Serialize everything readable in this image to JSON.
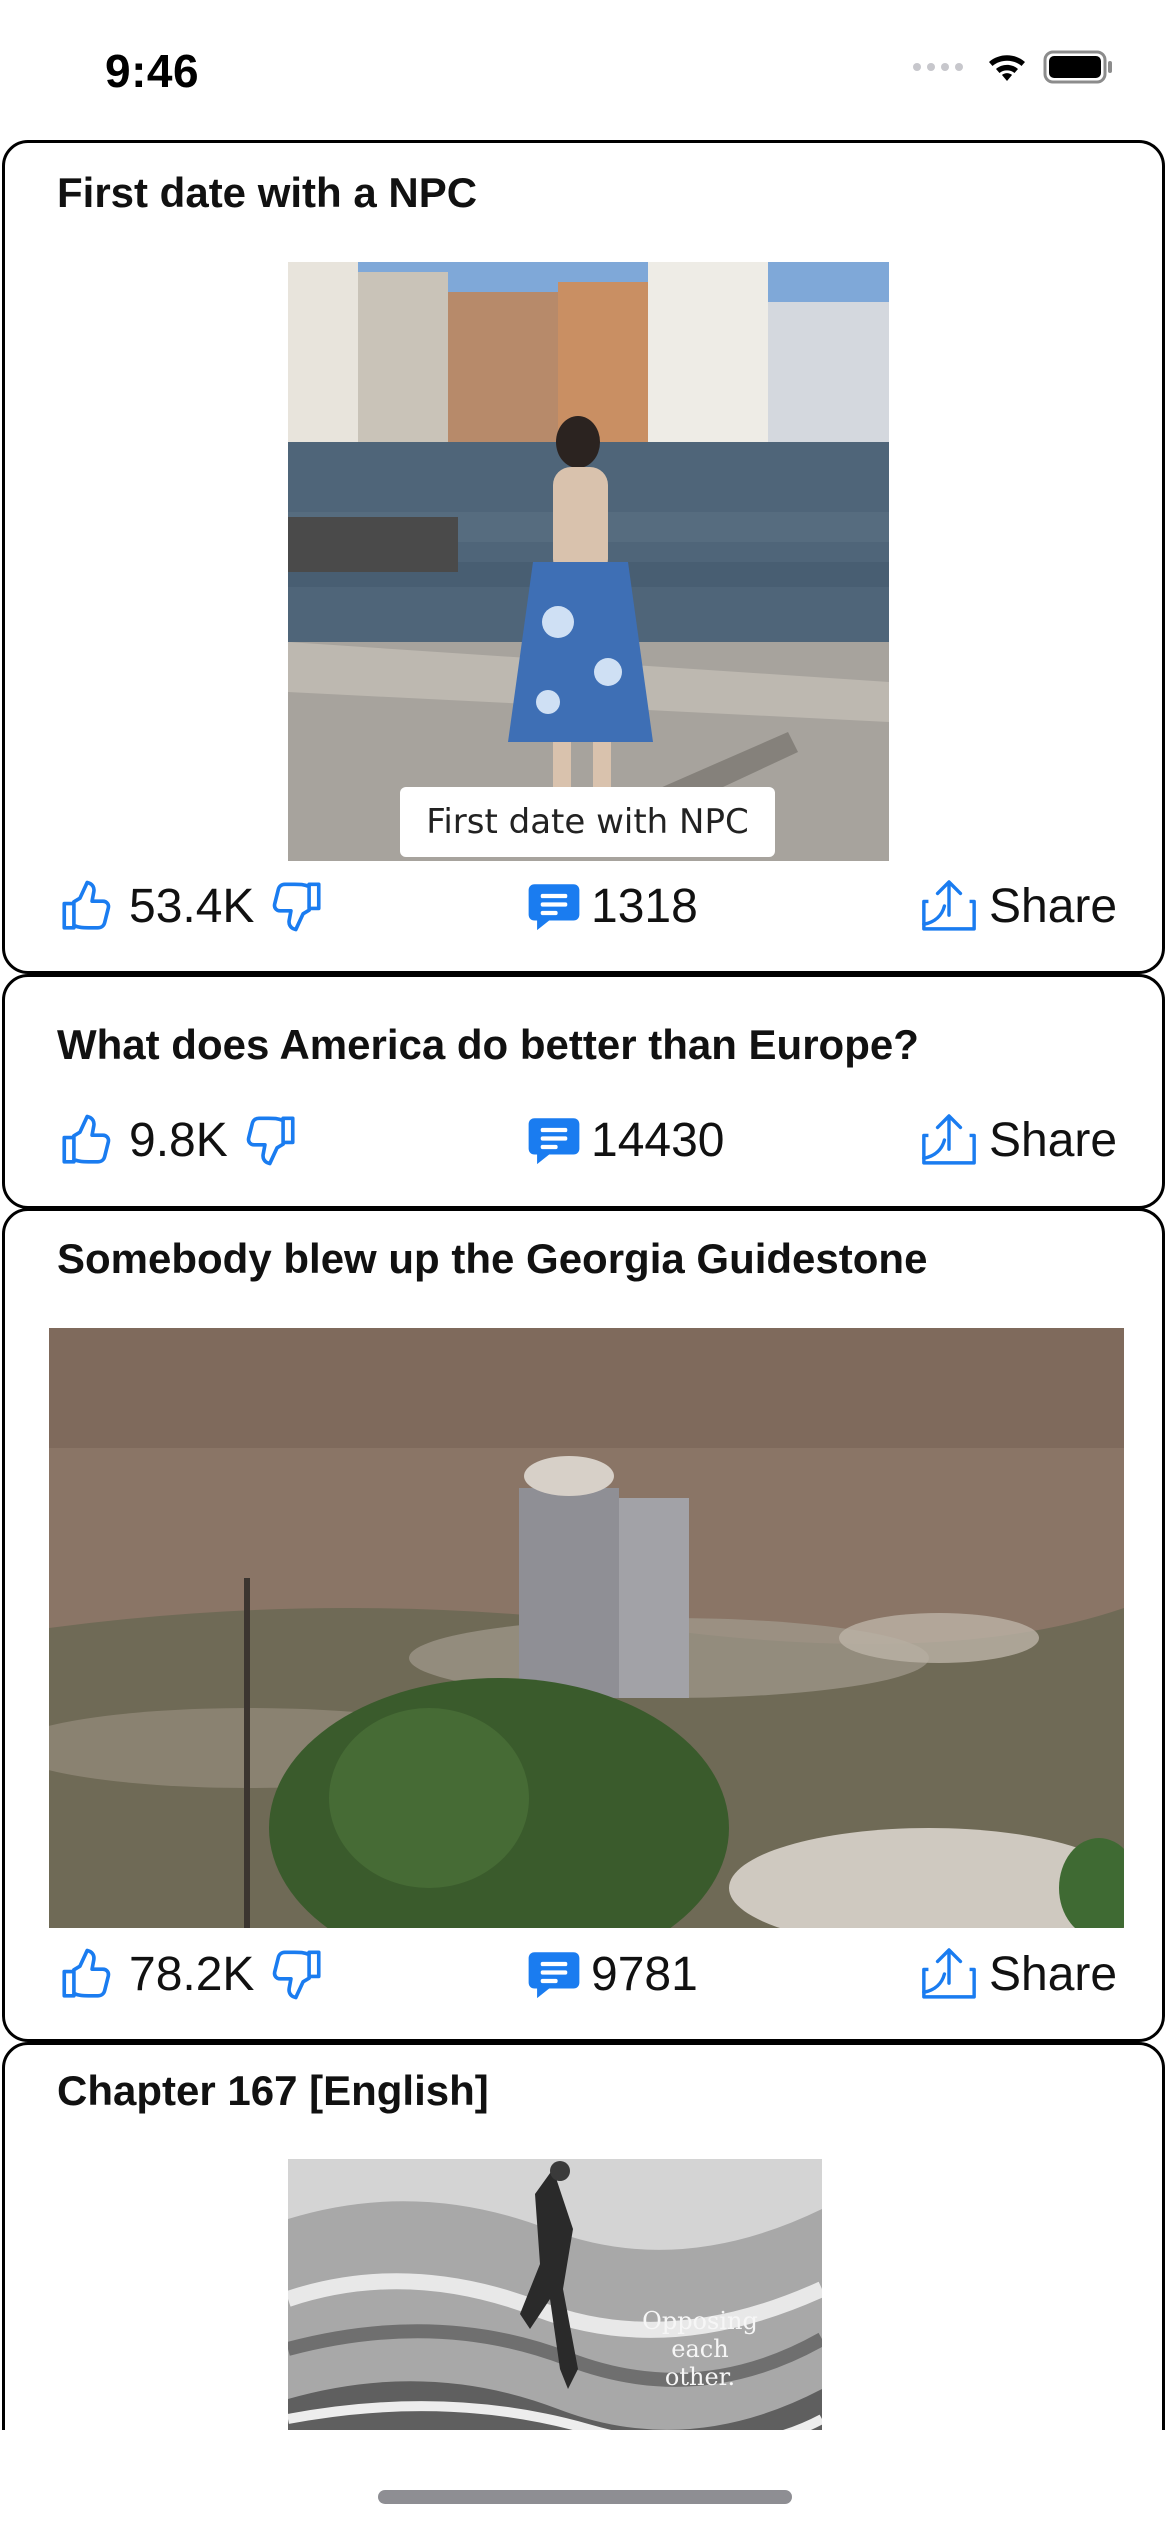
{
  "status_bar": {
    "time": "9:46"
  },
  "posts": [
    {
      "title": "First date with a NPC",
      "image_caption": "First date with NPC",
      "likes": "53.4K",
      "comments": "1318",
      "share_label": "Share"
    },
    {
      "title": "What does America do better than Europe?",
      "likes": "9.8K",
      "comments": "14430",
      "share_label": "Share"
    },
    {
      "title": "Somebody blew up the Georgia Guidestone",
      "likes": "78.2K",
      "comments": "9781",
      "share_label": "Share"
    },
    {
      "title": "Chapter 167 [English]",
      "image_caption": "Opposing each other."
    }
  ],
  "colors": {
    "accent": "#1a7cf0",
    "card_border": "#000000",
    "home_indicator": "#8e8e93"
  },
  "icons": {
    "like": "thumbs-up-icon",
    "dislike": "thumbs-down-icon",
    "comment": "comment-bubble-icon",
    "share": "share-icon",
    "wifi": "wifi-icon",
    "battery": "battery-icon"
  }
}
